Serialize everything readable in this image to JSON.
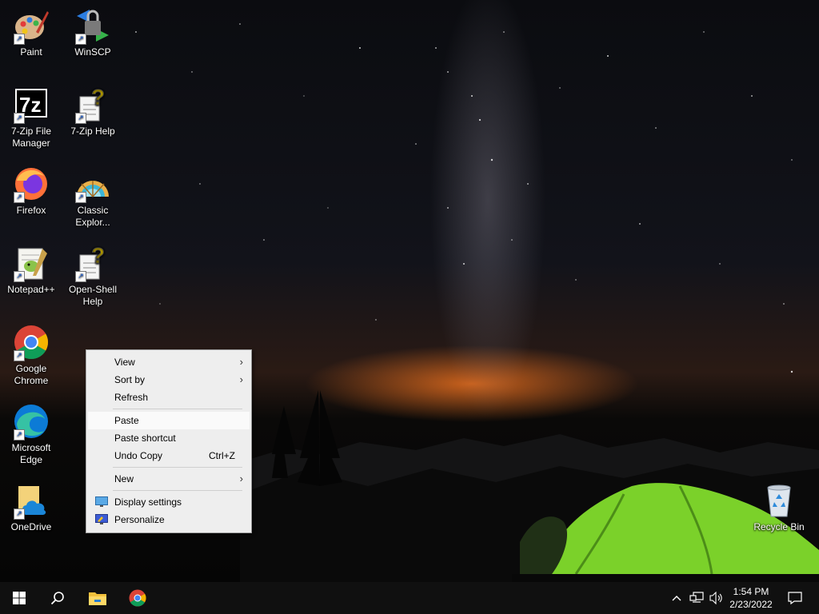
{
  "desktop_icons": [
    {
      "label": "Paint",
      "icon": "paint-icon"
    },
    {
      "label": "WinSCP",
      "icon": "winscp-icon"
    },
    {
      "label": "7-Zip File Manager",
      "icon": "7zip-icon"
    },
    {
      "label": "7-Zip Help",
      "icon": "help-document-icon"
    },
    {
      "label": "Firefox",
      "icon": "firefox-icon"
    },
    {
      "label": "Classic Explor...",
      "icon": "classic-explorer-icon"
    },
    {
      "label": "Notepad++",
      "icon": "notepad-plus-plus-icon"
    },
    {
      "label": "Open-Shell Help",
      "icon": "help-document-icon"
    },
    {
      "label": "Google Chrome",
      "icon": "chrome-icon"
    },
    {
      "label": "Microsoft Edge",
      "icon": "edge-icon"
    },
    {
      "label": "OneDrive",
      "icon": "onedrive-icon"
    },
    {
      "label": "Recycle Bin",
      "icon": "recycle-bin-icon"
    }
  ],
  "context_menu": {
    "items": [
      {
        "label": "View",
        "has_submenu": true
      },
      {
        "label": "Sort by",
        "has_submenu": true
      },
      {
        "label": "Refresh"
      },
      {
        "label": "Paste",
        "highlighted": true
      },
      {
        "label": "Paste shortcut"
      },
      {
        "label": "Undo Copy",
        "shortcut": "Ctrl+Z"
      },
      {
        "label": "New",
        "has_submenu": true
      },
      {
        "label": "Display settings",
        "icon": "display-settings-icon"
      },
      {
        "label": "Personalize",
        "icon": "personalize-icon"
      }
    ]
  },
  "taskbar": {
    "pinned": [
      "start-icon",
      "search-icon",
      "file-explorer-icon",
      "chrome-icon"
    ],
    "clock": {
      "time": "1:54 PM",
      "date": "2/23/2022"
    },
    "tray": [
      "chevron-up-icon",
      "network-icon",
      "volume-icon",
      "notification-icon"
    ]
  },
  "colors": {
    "accent": "#0078d7",
    "taskbar": "#101010",
    "menu_bg": "#eeeeee"
  }
}
